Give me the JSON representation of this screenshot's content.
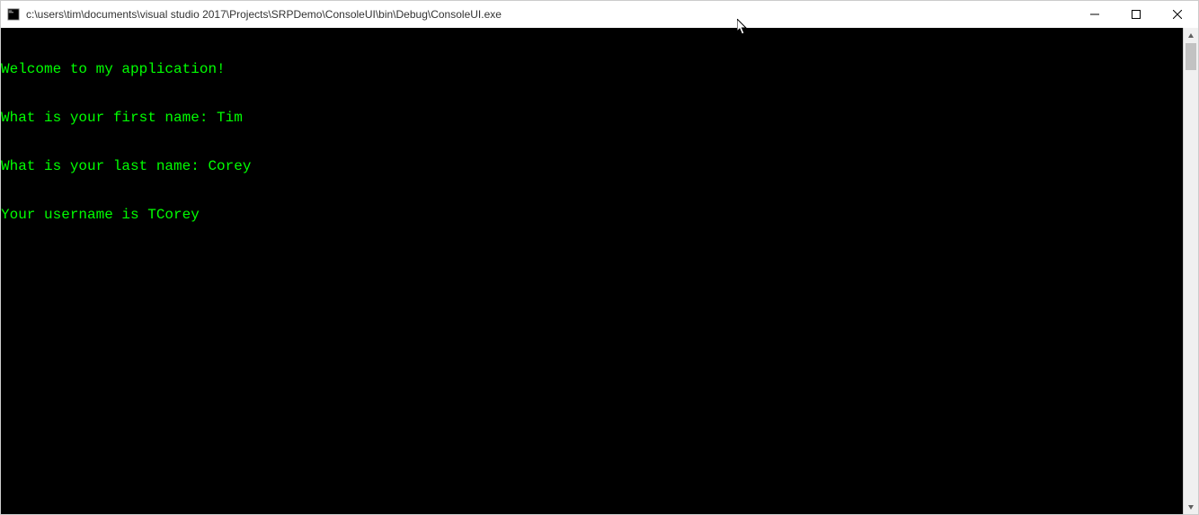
{
  "window": {
    "title": "c:\\users\\tim\\documents\\visual studio 2017\\Projects\\SRPDemo\\ConsoleUI\\bin\\Debug\\ConsoleUI.exe"
  },
  "console": {
    "lines": [
      "Welcome to my application!",
      "What is your first name: Tim",
      "What is your last name: Corey",
      "Your username is TCorey"
    ]
  }
}
